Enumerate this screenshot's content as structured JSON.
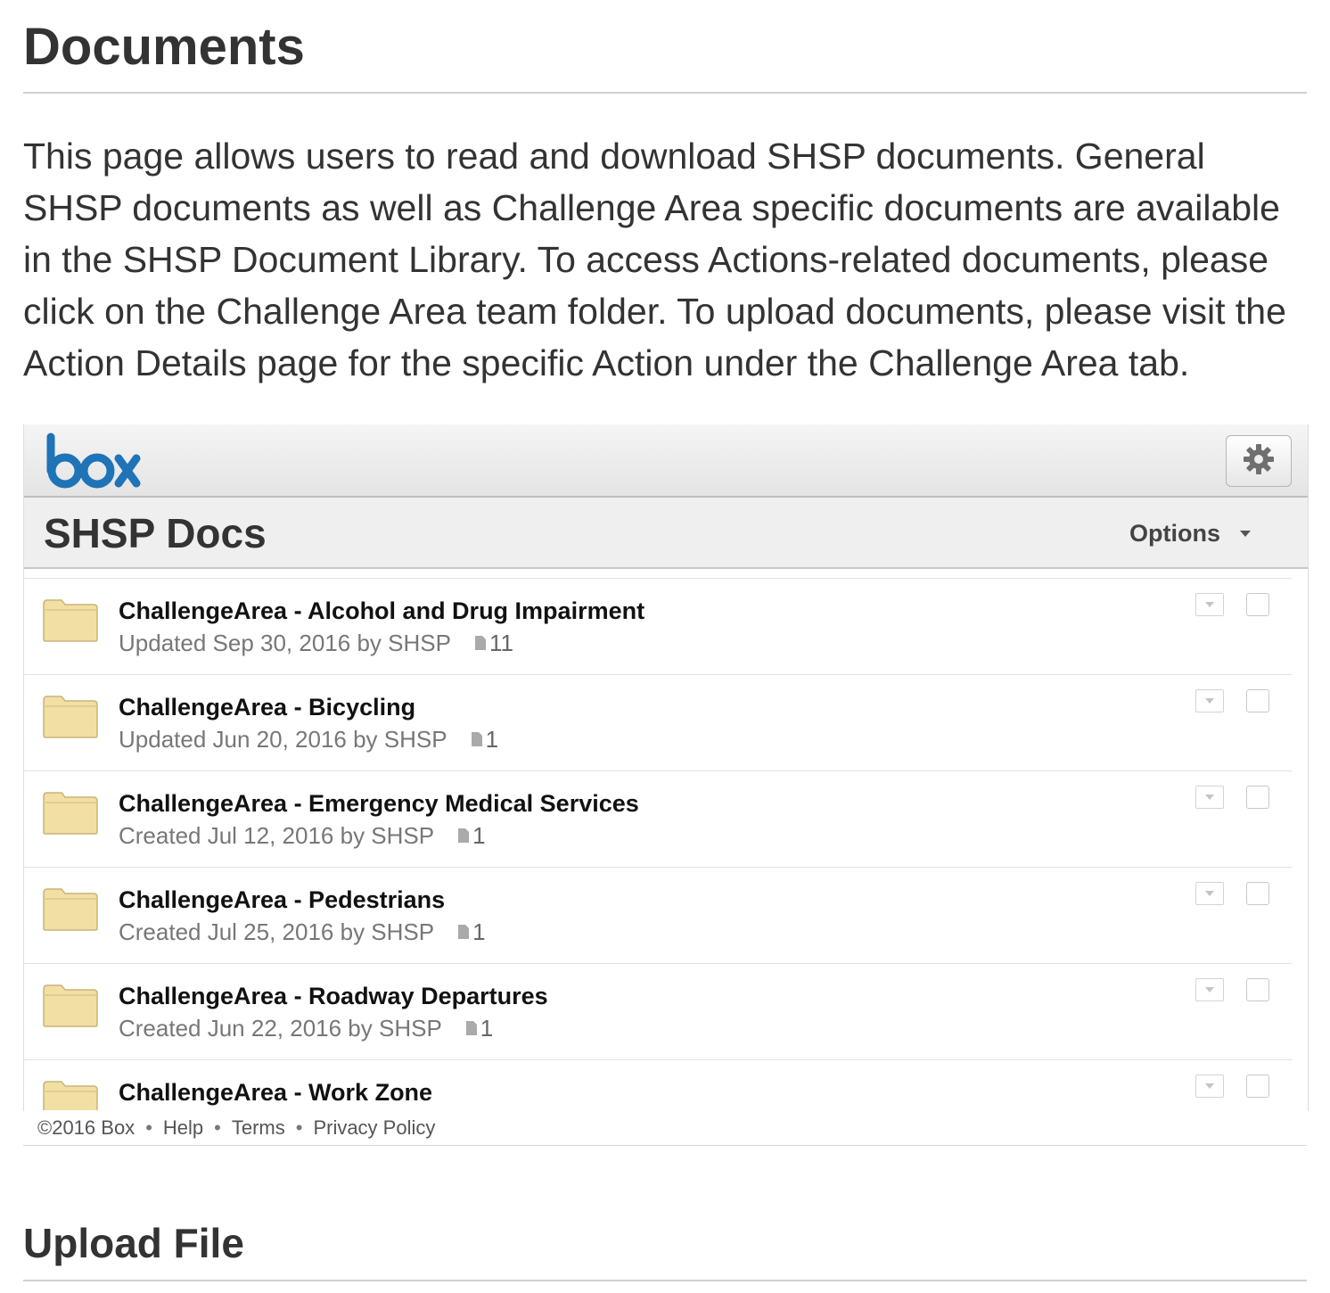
{
  "page": {
    "title": "Documents",
    "intro": "This page allows users to read and download SHSP documents. General SHSP documents as well as Challenge Area specific documents are available in the SHSP Document Library. To access Actions-related documents, please click on the Challenge Area team folder. To upload documents, please visit the Action Details page for the specific Action under the Challenge Area tab."
  },
  "box": {
    "logo_text": "box",
    "settings_icon": "gear-icon",
    "folder_title": "SHSP Docs",
    "options_label": "Options",
    "items": [
      {
        "name": "ChallengeArea - Alcohol and Drug Impairment",
        "meta": "Updated Sep 30, 2016 by SHSP",
        "count": "11"
      },
      {
        "name": "ChallengeArea - Bicycling",
        "meta": "Updated Jun 20, 2016 by SHSP",
        "count": "1"
      },
      {
        "name": "ChallengeArea - Emergency Medical Services",
        "meta": "Created Jul 12, 2016 by SHSP",
        "count": "1"
      },
      {
        "name": "ChallengeArea - Pedestrians",
        "meta": "Created Jul 25, 2016 by SHSP",
        "count": "1"
      },
      {
        "name": "ChallengeArea - Roadway Departures",
        "meta": "Created Jun 22, 2016 by SHSP",
        "count": "1"
      },
      {
        "name": "ChallengeArea - Work Zone",
        "meta": "",
        "count": ""
      }
    ],
    "footer": {
      "copyright": "©2016 Box",
      "help": "Help",
      "terms": "Terms",
      "privacy": "Privacy Policy",
      "separator": "•"
    }
  },
  "upload": {
    "title": "Upload File"
  },
  "colors": {
    "text": "#333333",
    "folder_fill": "#f2dfa3",
    "folder_stroke": "#c9b47a",
    "box_blue": "#1f73b7"
  }
}
